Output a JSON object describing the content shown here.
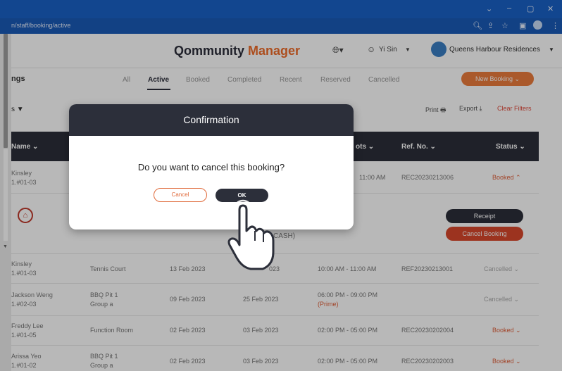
{
  "browser": {
    "url": "n/staff/booking/active",
    "window_controls": [
      "⌄",
      "–",
      "▢",
      "✕"
    ]
  },
  "header": {
    "brand_main": "Qommunity ",
    "brand_accent": "Manager",
    "user_name": "Yi Sin",
    "property_name": "Queens Harbour Residences"
  },
  "page": {
    "title": "ngs",
    "tabs": [
      "All",
      "Active",
      "Booked",
      "Completed",
      "Recent",
      "Reserved",
      "Cancelled"
    ],
    "active_tab": "Active",
    "new_booking": "New Booking",
    "filter_label": "s",
    "print": "Print",
    "export": "Export",
    "clear_filters": "Clear Filters"
  },
  "table": {
    "headers": {
      "name": "Name",
      "slots": "ots",
      "ref": "Ref. No.",
      "status": "Status"
    },
    "row1": {
      "name": "Kinsley",
      "unit": "1.#01-03",
      "time": "11:00 AM",
      "ref": "REC20230213006",
      "status": "Booked"
    },
    "detail": {
      "payment": "CASH)",
      "receipt": "Receipt",
      "cancel_booking": "Cancel Booking"
    },
    "rows": [
      {
        "name": "Kinsley",
        "unit": "1.#01-03",
        "facility": "Tennis Court",
        "facility2": "",
        "date1": "13 Feb 2023",
        "date2": "023",
        "time": "10:00 AM - 11:00 AM",
        "time2": "",
        "ref": "REF20230213001",
        "status": "Cancelled"
      },
      {
        "name": "Jackson Weng",
        "unit": "1.#02-03",
        "facility": "BBQ Pit 1",
        "facility2": "Group a",
        "date1": "09 Feb 2023",
        "date2": "25 Feb 2023",
        "time": "06:00 PM - 09:00 PM",
        "time2": "(Prime)",
        "ref": "",
        "status": "Cancelled"
      },
      {
        "name": "Freddy Lee",
        "unit": "1.#01-05",
        "facility": "Function Room",
        "facility2": "",
        "date1": "02 Feb 2023",
        "date2": "03 Feb 2023",
        "time": "02:00 PM - 05:00 PM",
        "time2": "",
        "ref": "REC20230202004",
        "status": "Booked"
      },
      {
        "name": "Arissa Yeo",
        "unit": "1.#01-02",
        "facility": "BBQ Pit 1",
        "facility2": "Group a",
        "date1": "02 Feb 2023",
        "date2": "03 Feb 2023",
        "time": "02:00 PM - 05:00 PM",
        "time2": "",
        "ref": "REC20230202003",
        "status": "Booked"
      }
    ]
  },
  "dialog": {
    "title": "Confirmation",
    "message": "Do you want to cancel this booking?",
    "cancel": "Cancel",
    "ok": "OK"
  },
  "colors": {
    "accent": "#ef6c2a",
    "dark": "#2c2f3a",
    "danger": "#d9472b",
    "chrome": "#1a62c6"
  }
}
